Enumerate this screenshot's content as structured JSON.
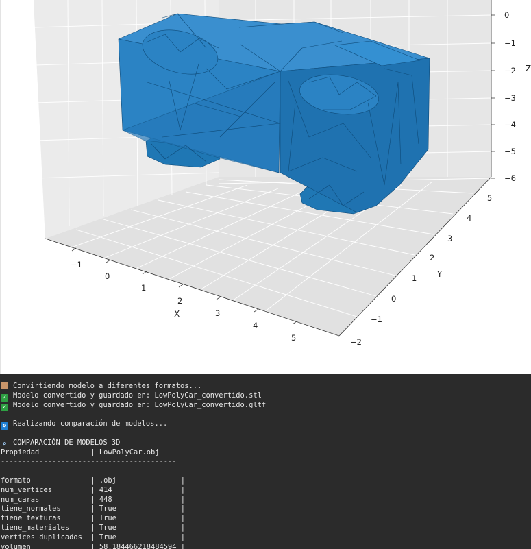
{
  "plot": {
    "x_axis": {
      "label": "X",
      "ticks": [
        "−1",
        "0",
        "1",
        "2",
        "3",
        "4",
        "5"
      ]
    },
    "y_axis": {
      "label": "Y",
      "ticks": [
        "−2",
        "−1",
        "0",
        "1",
        "2",
        "3",
        "4",
        "5"
      ]
    },
    "z_axis": {
      "label": "Z",
      "ticks": [
        "0",
        "−1",
        "−2",
        "−3",
        "−4",
        "−5",
        "−6"
      ]
    },
    "mesh_color": "#1f77b4",
    "mesh_edge_color": "#0d3f66"
  },
  "console": {
    "lines": [
      {
        "icon": "package-icon",
        "text": "Convirtiendo modelo a diferentes formatos..."
      },
      {
        "icon": "checkmark-icon",
        "text": "Modelo convertido y guardado en: LowPolyCar_convertido.stl"
      },
      {
        "icon": "checkmark-icon",
        "text": "Modelo convertido y guardado en: LowPolyCar_convertido.gltf"
      },
      {
        "icon": "",
        "text": ""
      },
      {
        "icon": "refresh-icon",
        "text": "Realizando comparación de modelos..."
      },
      {
        "icon": "",
        "text": ""
      },
      {
        "icon": "magnifier-icon",
        "text": "COMPARACIÓN DE MODELOS 3D"
      }
    ],
    "table": {
      "header": {
        "property": "Propiedad",
        "model": "LowPolyCar.obj"
      },
      "separator": "-----------------------------------------",
      "rows": [
        {
          "property": "formato",
          "value": ".obj"
        },
        {
          "property": "num_vertices",
          "value": "414"
        },
        {
          "property": "num_caras",
          "value": "448"
        },
        {
          "property": "tiene_normales",
          "value": "True"
        },
        {
          "property": "tiene_texturas",
          "value": "True"
        },
        {
          "property": "tiene_materiales",
          "value": "True"
        },
        {
          "property": "vertices_duplicados",
          "value": "True"
        },
        {
          "property": "volumen",
          "value": "58.184466218484594"
        }
      ]
    }
  }
}
